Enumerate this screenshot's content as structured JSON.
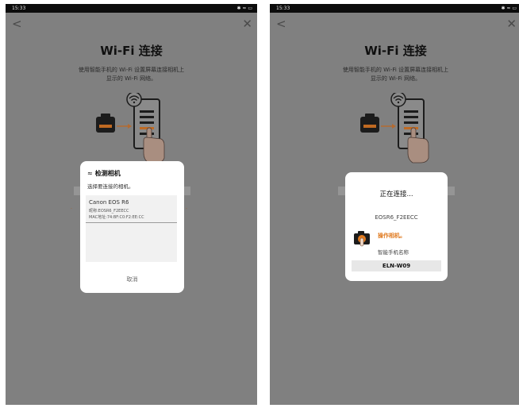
{
  "status": {
    "time": "15:33",
    "icons": "✱ ≈ ▭"
  },
  "nav": {
    "back": "<",
    "close": "✕"
  },
  "page": {
    "title": "Wi-Fi 连接",
    "instruction_line1": "使用智能手机的 Wi-Fi 设置屏幕连接相机上",
    "instruction_line2": "显示的 Wi-Fi 网络。"
  },
  "detect_dialog": {
    "title": "检测相机",
    "subtitle": "选择要连接的相机。",
    "cameras": [
      {
        "name": "Canon EOS R6",
        "nickname": "昵称:EOSR6_F2EECC",
        "mac": "MAC地址:74:BF:C0:F2:EE:CC"
      }
    ],
    "cancel": "取消"
  },
  "connect_dialog": {
    "title": "正在连接...",
    "camera_name": "EOSR6_F2EECC",
    "operate": "操作相机。",
    "phone_label": "智能手机名称",
    "phone_value": "ELN-W09"
  },
  "colors": {
    "accent": "#e07a1f",
    "overlay": "#808080"
  }
}
